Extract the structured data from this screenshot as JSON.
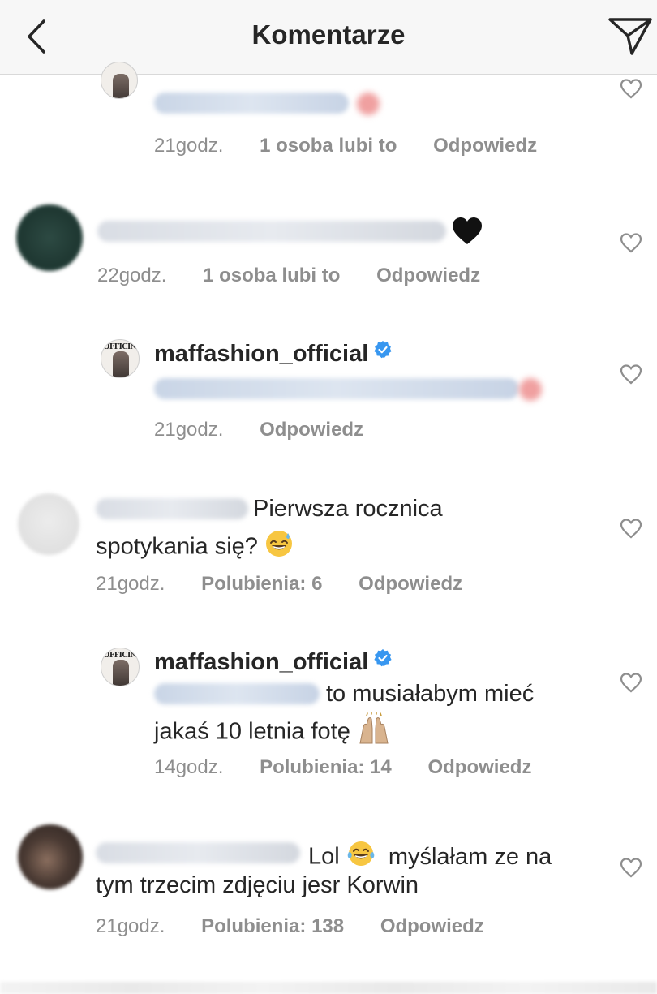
{
  "header": {
    "title": "Komentarze",
    "back_icon": "chevron-left-icon",
    "send_icon": "direct-send-icon"
  },
  "comments": [
    {
      "time": "21godz.",
      "likes": "1 osoba lubi to",
      "reply": "Odpowiedz"
    },
    {
      "time": "22godz.",
      "likes": "1 osoba lubi to",
      "reply": "Odpowiedz",
      "emoji": "🖤"
    },
    {
      "username": "maffashion_official",
      "verified": true,
      "avatar_text": "OFFICIN",
      "time": "21godz.",
      "reply": "Odpowiedz"
    },
    {
      "text_line1": "Pierwsza rocznica",
      "text_line2": "spotykania się?",
      "emoji": "😅",
      "time": "21godz.",
      "likes": "Polubienia: 6",
      "reply": "Odpowiedz"
    },
    {
      "username": "maffashion_official",
      "verified": true,
      "avatar_text": "OFFICIN",
      "text_line1": "to musiałabym mieć",
      "text_line2": "jakaś 10 letnia fotę",
      "emoji": "🙌",
      "time": "14godz.",
      "likes": "Polubienia: 14",
      "reply": "Odpowiedz"
    },
    {
      "text_line1_a": "Lol",
      "emoji": "😂",
      "text_line1_b": "myślałam ze na",
      "text_line2": "tym trzecim zdjęciu jesr Korwin",
      "time": "21godz.",
      "likes": "Polubienia: 138",
      "reply": "Odpowiedz"
    }
  ],
  "colors": {
    "text": "#262626",
    "meta": "#8e8e8e",
    "verified": "#3897f0",
    "header_bg": "#f7f7f7"
  }
}
